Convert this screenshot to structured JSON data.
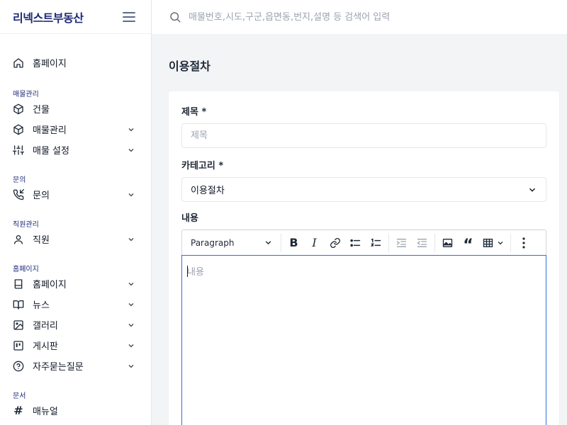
{
  "brand": "리넥스트부동산",
  "search": {
    "placeholder": "매물번호,시도,구군,읍면동,번지,설명 등 검색어 입력"
  },
  "sidebar": {
    "home": "홈페이지",
    "sections": [
      {
        "title": "매물관리",
        "items": [
          {
            "label": "건물",
            "icon": "cube-icon",
            "expandable": false
          },
          {
            "label": "매물관리",
            "icon": "cube-icon",
            "expandable": true
          },
          {
            "label": "매물 설정",
            "icon": "sliders-icon",
            "expandable": true
          }
        ]
      },
      {
        "title": "문의",
        "items": [
          {
            "label": "문의",
            "icon": "phone-incoming-icon",
            "expandable": true
          }
        ]
      },
      {
        "title": "직원관리",
        "items": [
          {
            "label": "직원",
            "icon": "user-icon",
            "expandable": true
          }
        ]
      },
      {
        "title": "홈페이지",
        "items": [
          {
            "label": "홈페이지",
            "icon": "book-icon",
            "expandable": true
          },
          {
            "label": "뉴스",
            "icon": "book-open-icon",
            "expandable": true
          },
          {
            "label": "갤러리",
            "icon": "image-icon",
            "expandable": true
          },
          {
            "label": "게시판",
            "icon": "board-icon",
            "expandable": true
          },
          {
            "label": "자주묻는질문",
            "icon": "help-circle-icon",
            "expandable": true
          }
        ]
      },
      {
        "title": "문서",
        "items": [
          {
            "label": "매뉴얼",
            "icon": "hash-icon",
            "expandable": false
          }
        ]
      }
    ]
  },
  "page": {
    "title": "이용절차"
  },
  "form": {
    "title_label": "제목 *",
    "title_placeholder": "제목",
    "category_label": "카테고리 *",
    "category_value": "이용절차",
    "content_label": "내용",
    "content_placeholder": "내용",
    "heading_select": "Paragraph"
  },
  "colors": {
    "brand": "#1e2a78",
    "editor_focus_border": "#2f6fd8",
    "background": "#f3f4f6"
  }
}
